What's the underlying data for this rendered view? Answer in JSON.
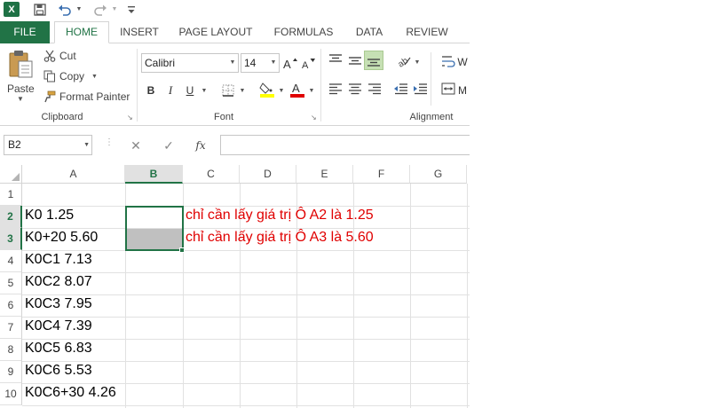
{
  "qat": {
    "app_icon": "X",
    "icons": [
      "excel-icon",
      "save-icon",
      "undo-icon",
      "redo-icon",
      "customize-icon"
    ]
  },
  "tabs": [
    "FILE",
    "HOME",
    "INSERT",
    "PAGE LAYOUT",
    "FORMULAS",
    "DATA",
    "REVIEW"
  ],
  "clipboard": {
    "paste": "Paste",
    "cut": "Cut",
    "copy": "Copy",
    "format_painter": "Format Painter",
    "label": "Clipboard"
  },
  "font": {
    "name": "Calibri",
    "size": "14",
    "bold": "B",
    "italic": "I",
    "underline": "U",
    "label": "Font"
  },
  "alignment": {
    "wrap": "W",
    "merge": "M",
    "label": "Alignment"
  },
  "formula_bar": {
    "name_box": "B2",
    "fx": "fx",
    "content": ""
  },
  "columns": [
    "A",
    "B",
    "C",
    "D",
    "E",
    "F",
    "G"
  ],
  "selected_column": "B",
  "rows": [
    "1",
    "2",
    "3",
    "4",
    "5",
    "6",
    "7",
    "8",
    "9",
    "10"
  ],
  "selected_rows": [
    "2",
    "3"
  ],
  "cells": {
    "A2": "K0 1.25",
    "A3": "K0+20 5.60",
    "A4": "K0C1 7.13",
    "A5": "K0C2 8.07",
    "A6": "K0C3 7.95",
    "A7": "K0C4 7.39",
    "A8": "K0C5 6.83",
    "A9": "K0C6 5.53",
    "A10": "K0C6+30 4.26",
    "C2": "chỉ cần lấy giá trị Ô A2 là 1.25",
    "C3": "chỉ cần lấy giá trị Ô A3 là 5.60"
  },
  "colors": {
    "accent": "#217346",
    "note_text": "#e00000",
    "fill_b3": "#c0c0c0"
  }
}
